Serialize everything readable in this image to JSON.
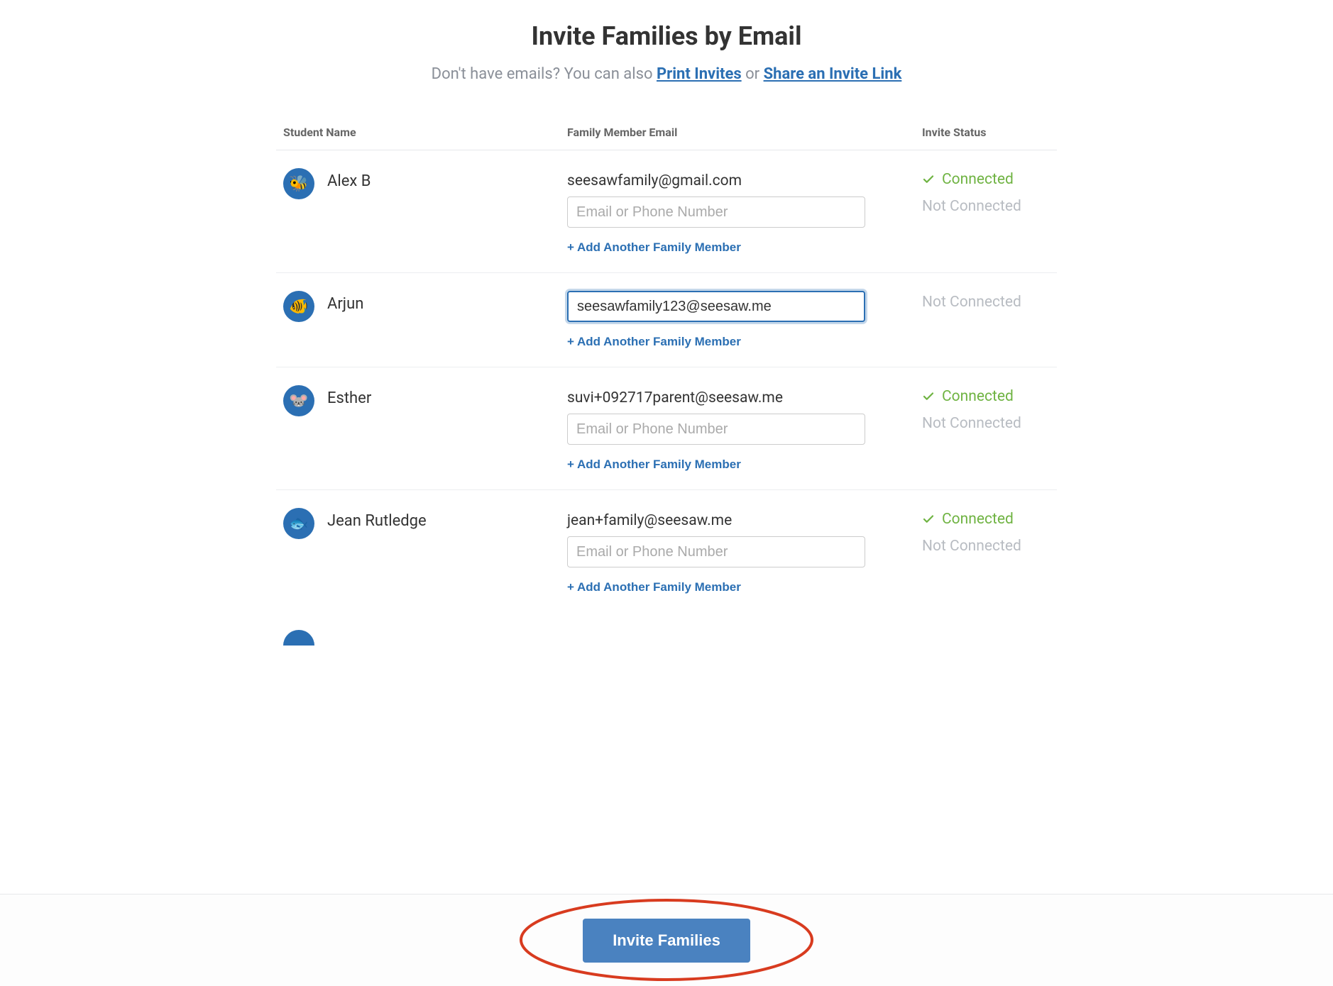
{
  "title": "Invite Families by Email",
  "subtitle": {
    "pre": "Don't have emails? You can also ",
    "link1": "Print Invites",
    "mid": " or ",
    "link2": "Share an Invite Link"
  },
  "headers": {
    "name": "Student Name",
    "email": "Family Member Email",
    "status": "Invite Status"
  },
  "labels": {
    "add_another": "+ Add Another Family Member",
    "placeholder": "Email or Phone Number",
    "connected": "Connected",
    "not_connected": "Not Connected",
    "invite": "Invite Families"
  },
  "students": [
    {
      "name": "Alex B",
      "avatar": "🐝",
      "emails": [
        {
          "value": "seesawfamily@gmail.com",
          "connected": true,
          "editable": false
        },
        {
          "value": "",
          "connected": false,
          "editable": true,
          "focused": false
        }
      ]
    },
    {
      "name": "Arjun",
      "avatar": "🐠",
      "emails": [
        {
          "value": "seesawfamily123@seesaw.me",
          "connected": false,
          "editable": true,
          "focused": true
        }
      ]
    },
    {
      "name": "Esther",
      "avatar": "🐭",
      "emails": [
        {
          "value": "suvi+092717parent@seesaw.me",
          "connected": true,
          "editable": false
        },
        {
          "value": "",
          "connected": false,
          "editable": true,
          "focused": false
        }
      ]
    },
    {
      "name": "Jean Rutledge",
      "avatar": "🐟",
      "emails": [
        {
          "value": "jean+family@seesaw.me",
          "connected": true,
          "editable": false
        },
        {
          "value": "",
          "connected": false,
          "editable": true,
          "focused": false
        }
      ]
    }
  ]
}
